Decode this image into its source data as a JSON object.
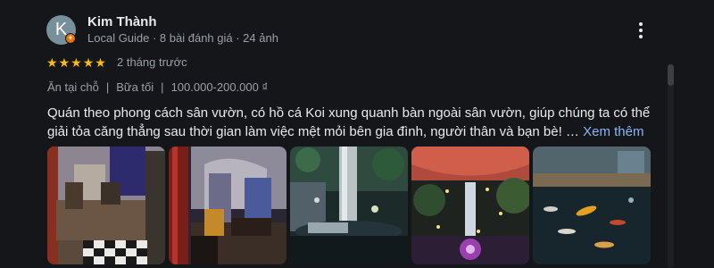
{
  "author": {
    "initial": "K",
    "name": "Kim Thành",
    "meta": "Local Guide · 8 bài đánh giá · 24 ảnh"
  },
  "rating": {
    "stars": 5,
    "max": 5
  },
  "date": "2 tháng trước",
  "attributes": [
    "Ăn tại chỗ",
    "Bữa tối",
    "100.000-200.000 ₫"
  ],
  "review": {
    "text": "Quán theo phong cách sân vườn, có hồ cá Koi xung quanh bàn ngoài sân vườn, giúp chúng ta có thể giải tỏa căng thẳng sau thời gian làm việc mệt mỏi bên gia đình, người thân và bạn bè!",
    "ellipsis": " … ",
    "more_label": "Xem thêm"
  },
  "photos": [
    {
      "icon": "restaurant-interior-photo"
    },
    {
      "icon": "restaurant-lounge-photo"
    },
    {
      "icon": "garden-waterfall-photo"
    },
    {
      "icon": "garden-lights-photo"
    },
    {
      "icon": "koi-pond-photo"
    }
  ],
  "colors": {
    "background": "#151619",
    "star": "#fbbc04",
    "link": "#8ab4f8",
    "badge": "#e8710a"
  }
}
